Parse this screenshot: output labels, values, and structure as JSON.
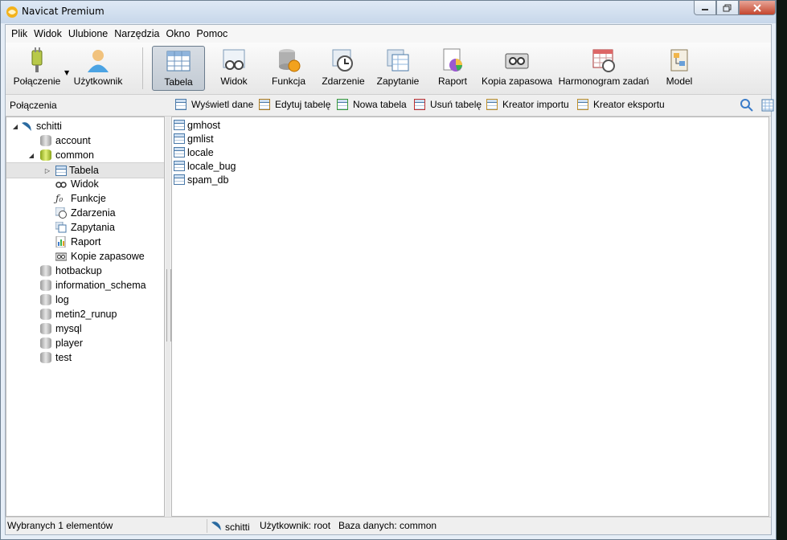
{
  "window": {
    "title": "Navicat Premium"
  },
  "menu": [
    "Plik",
    "Widok",
    "Ulubione",
    "Narzędzia",
    "Okno",
    "Pomoc"
  ],
  "toolbar": {
    "connection": "Połączenie",
    "user": "Użytkownik",
    "table": "Tabela",
    "view": "Widok",
    "function": "Funkcja",
    "event": "Zdarzenie",
    "query": "Zapytanie",
    "report": "Raport",
    "backup": "Kopia zapasowa",
    "schedule": "Harmonogram zadań",
    "model": "Model"
  },
  "subbar": {
    "label": "Połączenia",
    "actions": {
      "show_data": "Wyświetl dane",
      "edit_table": "Edytuj tabelę",
      "new_table": "Nowa tabela",
      "delete_table": "Usuń tabelę",
      "import_wizard": "Kreator importu",
      "export_wizard": "Kreator eksportu"
    }
  },
  "tree": {
    "connection": "schitti",
    "databases": {
      "account": "account",
      "common": "common",
      "hotbackup": "hotbackup",
      "information_schema": "information_schema",
      "log": "log",
      "metin2_runup": "metin2_runup",
      "mysql": "mysql",
      "player": "player",
      "test": "test"
    },
    "common_children": {
      "tables": "Tabela",
      "views": "Widok",
      "functions": "Funkcje",
      "events": "Zdarzenia",
      "queries": "Zapytania",
      "reports": "Raport",
      "backups": "Kopie zapasowe"
    }
  },
  "tables": [
    "gmhost",
    "gmlist",
    "locale",
    "locale_bug",
    "spam_db"
  ],
  "status": {
    "selected": "Wybranych 1 elementów",
    "connection": "schitti",
    "user": "Użytkownik: root",
    "database": "Baza danych: common"
  },
  "colors": {
    "accent": "#4a79a8",
    "db_open": "#9fbf1c"
  }
}
